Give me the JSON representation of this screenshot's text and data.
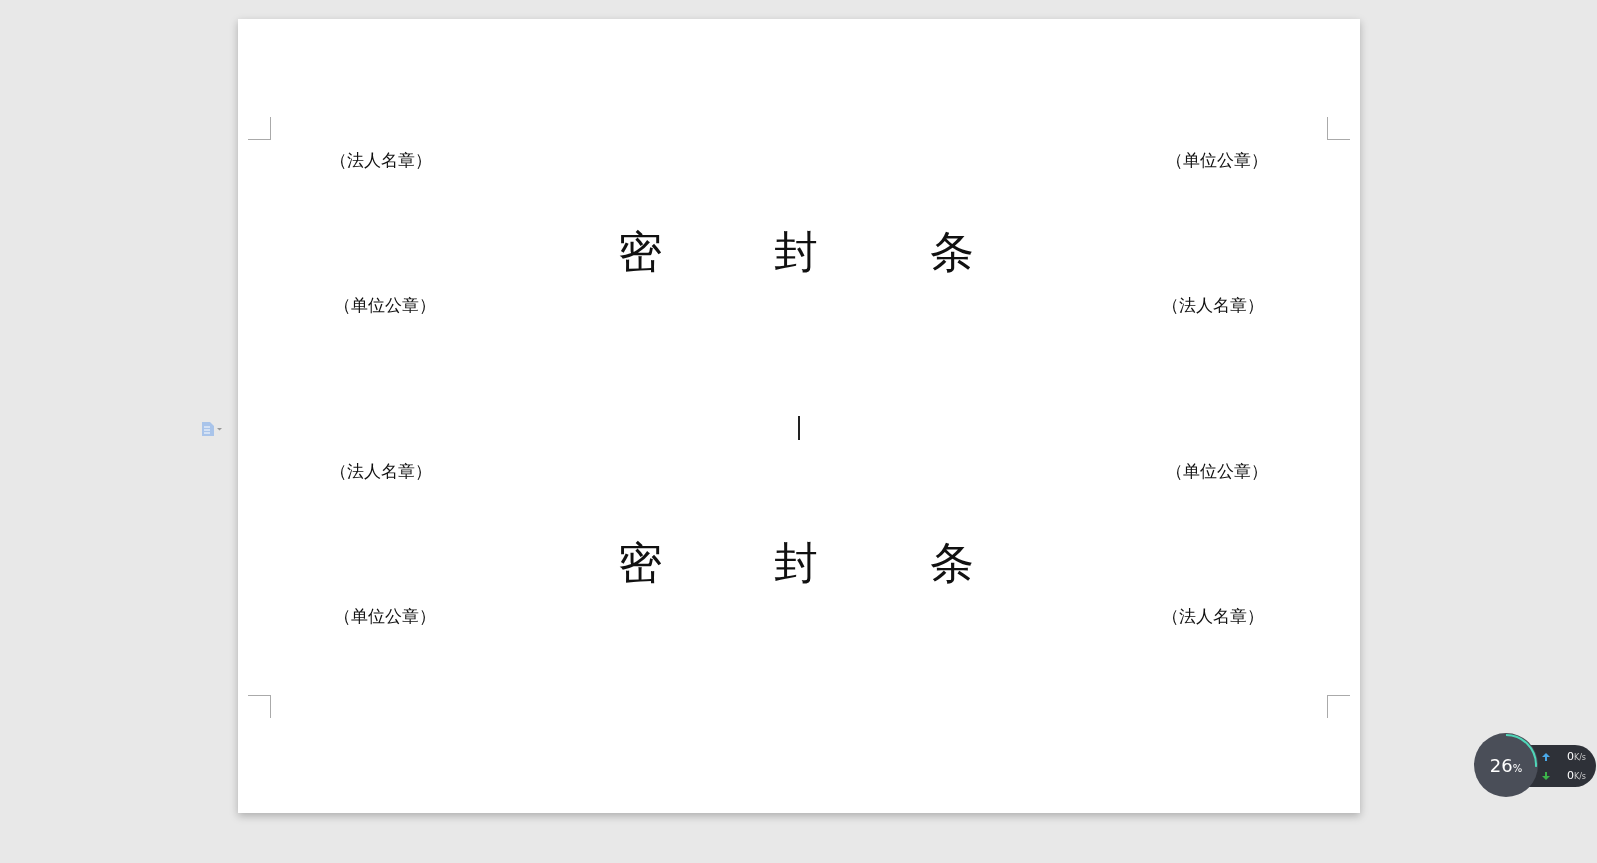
{
  "document": {
    "seal_blocks": [
      {
        "top_left": "（法人名章）",
        "top_right": "（单位公章）",
        "title": [
          "密",
          "封",
          "条"
        ],
        "bottom_left": "（单位公章）",
        "bottom_right": "（法人名章）"
      },
      {
        "top_left": "（法人名章）",
        "top_right": "（单位公章）",
        "title": [
          "密",
          "封",
          "条"
        ],
        "bottom_left": "（单位公章）",
        "bottom_right": "（法人名章）"
      }
    ]
  },
  "network_widget": {
    "percent": "26",
    "percent_sign": "%",
    "upload": "0",
    "upload_unit": "K/s",
    "download": "0",
    "download_unit": "K/s",
    "level": 0.26
  }
}
